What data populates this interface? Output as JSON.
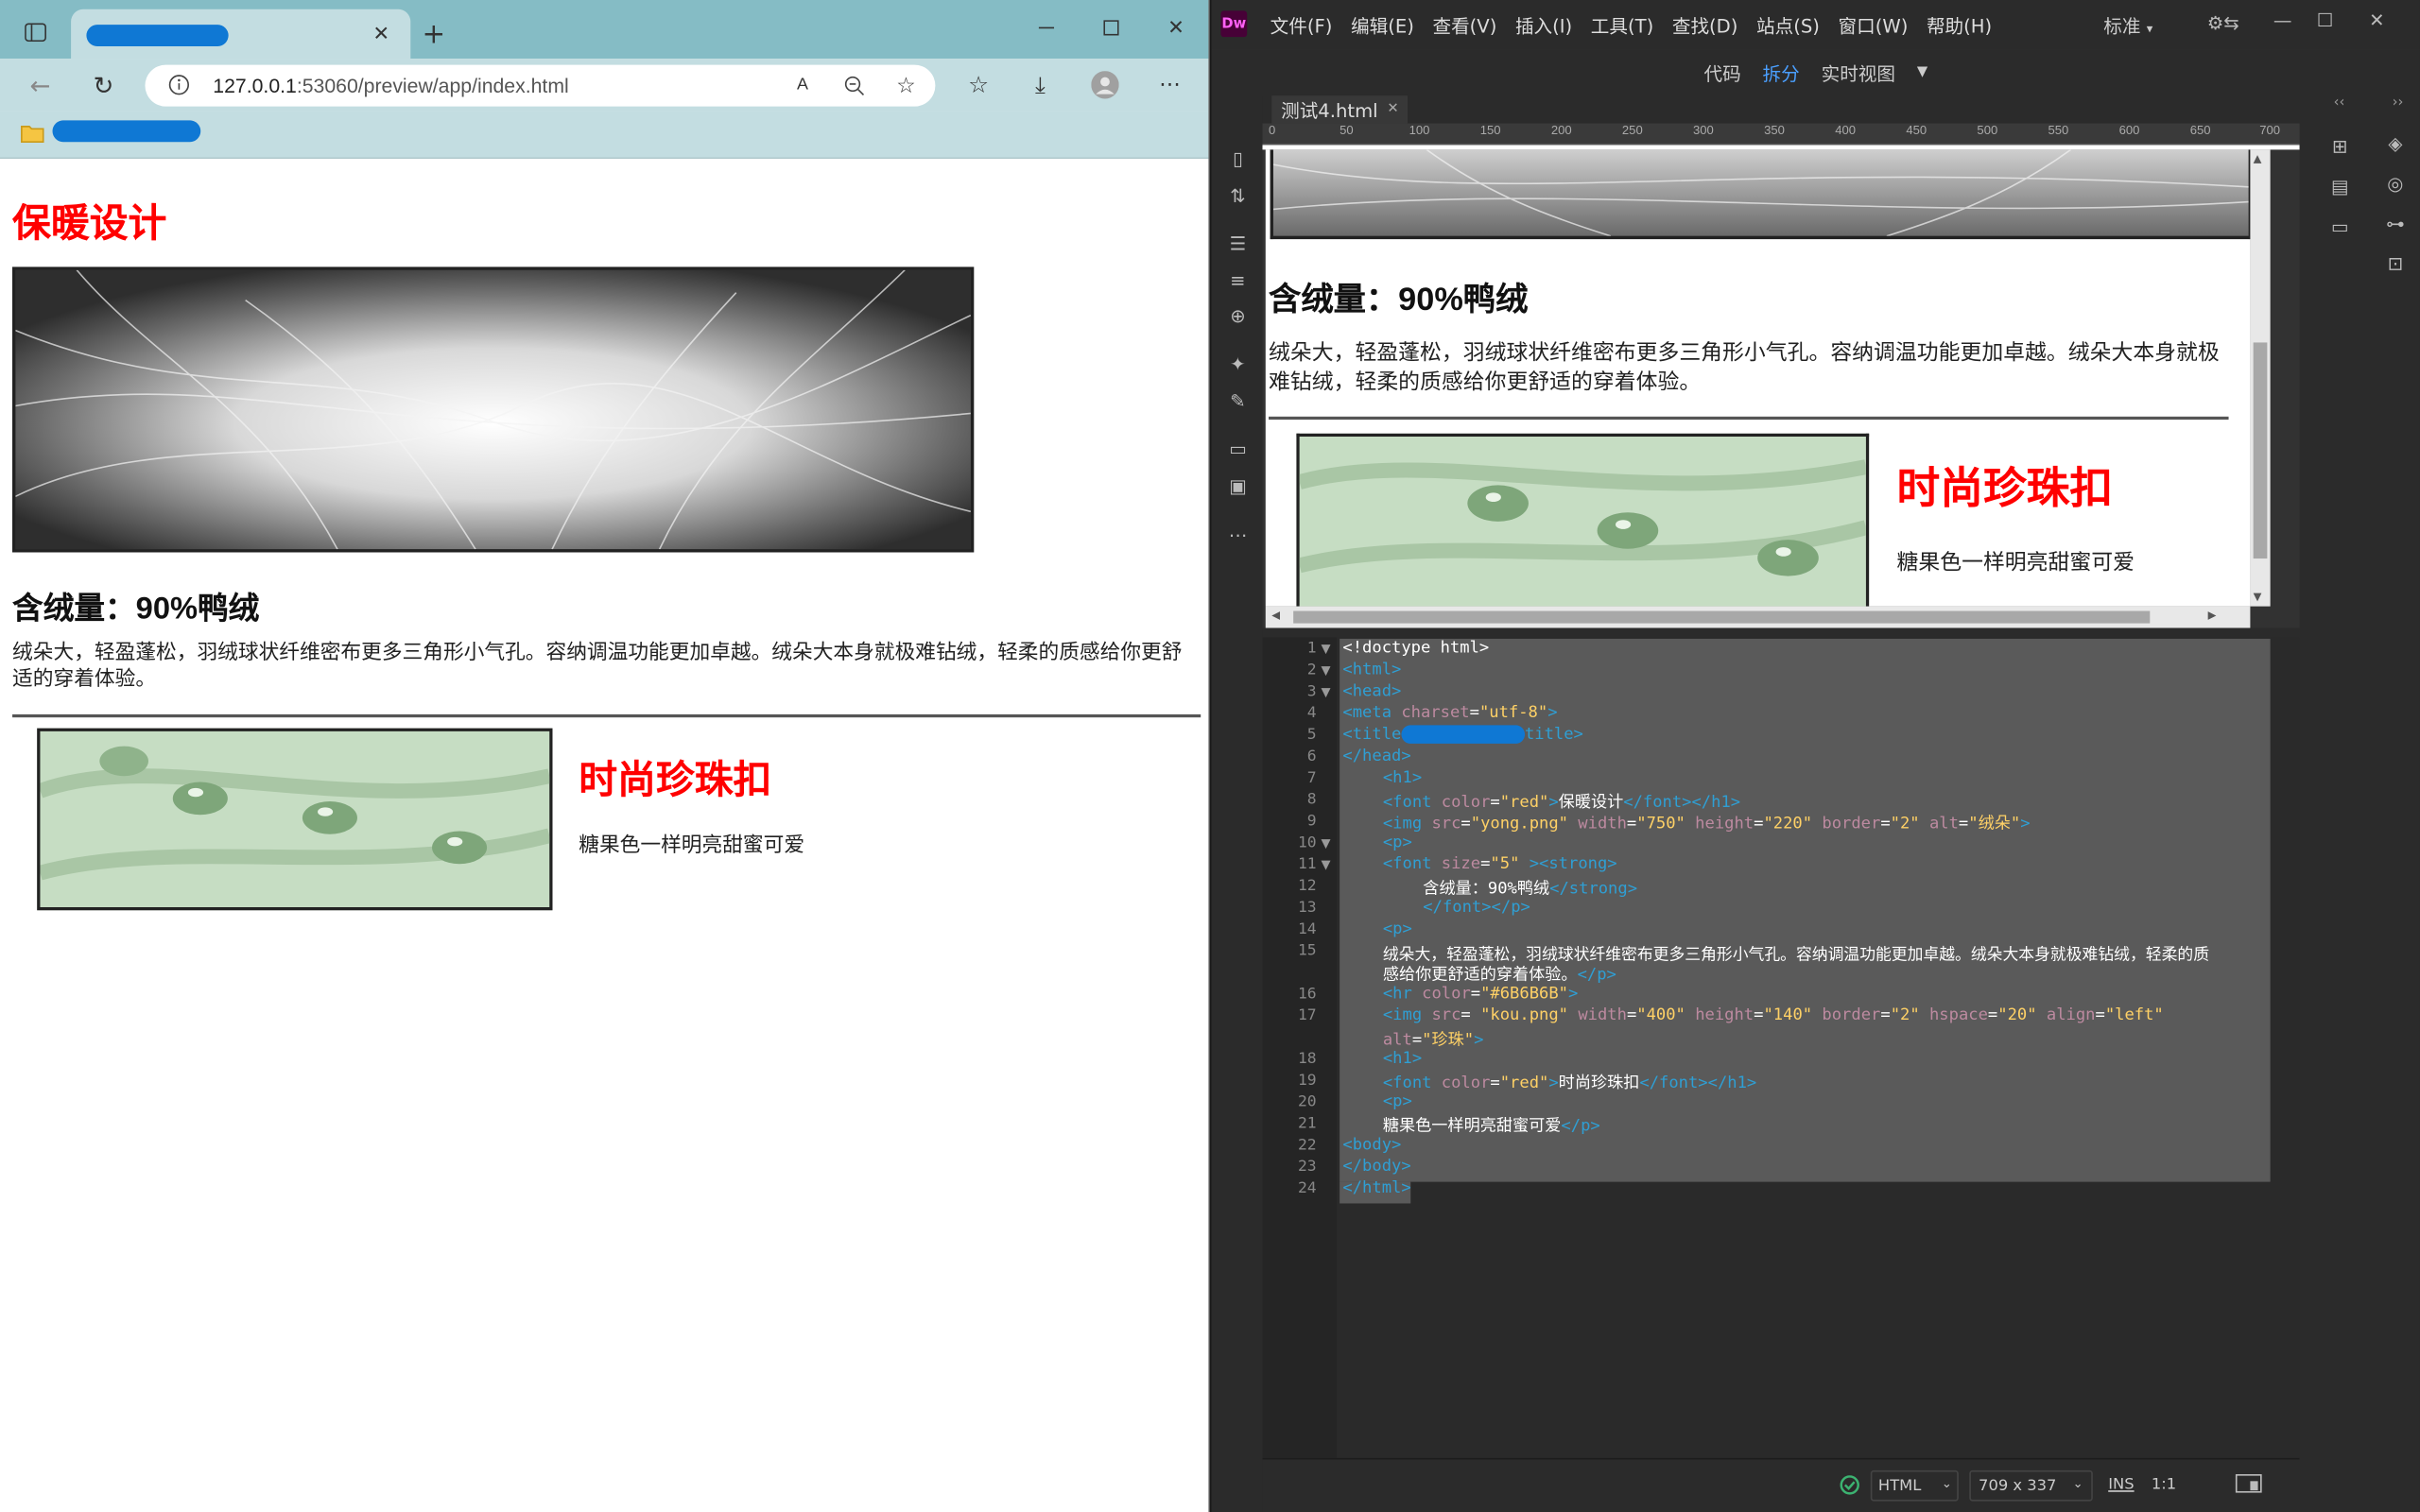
{
  "browser": {
    "url_host": "127.0.0.1",
    "url_rest": ":53060/preview/app/index.html",
    "page": {
      "h1": "保暖设计",
      "h2": "含绒量：90%鸭绒",
      "paragraph": "绒朵大，轻盈蓬松，羽绒球状纤维密布更多三角形小气孔。容纳调温功能更加卓越。绒朵大本身就极难钻绒，轻柔的质感给你更舒适的穿着体验。",
      "h3": "时尚珍珠扣",
      "p2": "糖果色一样明亮甜蜜可爱"
    }
  },
  "dreamweaver": {
    "logo": "Dw",
    "menus": [
      "文件(F)",
      "编辑(E)",
      "查看(V)",
      "插入(I)",
      "工具(T)",
      "查找(D)",
      "站点(S)",
      "窗口(W)",
      "帮助(H)"
    ],
    "workspace": "标准",
    "views": {
      "code": "代码",
      "split": "拆分",
      "live": "实时视图"
    },
    "doc_tab": "测试4.html",
    "ruler": [
      "0",
      "50",
      "100",
      "150",
      "200",
      "250",
      "300",
      "350",
      "400",
      "450",
      "500",
      "550",
      "600",
      "650",
      "700"
    ],
    "live": {
      "h2": "含绒量：90%鸭绒",
      "paragraph": "绒朵大，轻盈蓬松，羽绒球状纤维密布更多三角形小气孔。容纳调温功能更加卓越。绒朵大本身就极难钻绒，轻柔的质感给你更舒适的穿着体验。",
      "h3": "时尚珍珠扣",
      "p2": "糖果色一样明亮甜蜜可爱"
    },
    "line_numbers": [
      "1",
      "2",
      "3",
      "4",
      "5",
      "6",
      "7",
      "8",
      "9",
      "10",
      "11",
      "12",
      "13",
      "14",
      "15",
      "16",
      "17",
      "18",
      "19",
      "20",
      "21",
      "22",
      "23",
      "24"
    ],
    "code": {
      "l1": "<!doctype html>",
      "l2": "<html>",
      "l3": "<head>",
      "l4a": "<meta ",
      "l4b": "charset",
      "l4c": "=",
      "l4d": "\"utf-8\"",
      "l4e": ">",
      "l5a": "<title",
      "l5b": "title>",
      "l6": "</head>",
      "l7": "<h1>",
      "l8a": "<font ",
      "l8b": "color",
      "l8c": "=",
      "l8d": "\"red\"",
      "l8e": ">",
      "l8f": "保暖设计",
      "l8g": "</font></h1>",
      "l9a": "<img ",
      "l9b": "src",
      "l9c": "=",
      "l9d": "\"yong.png\"",
      "l9e": " width",
      "l9f": "=",
      "l9g": "\"750\"",
      "l9h": " height",
      "l9i": "=",
      "l9j": "\"220\"",
      "l9k": " border",
      "l9l": "=",
      "l9m": "\"2\"",
      "l9n": " alt",
      "l9o": "=",
      "l9p": "\"绒朵\"",
      "l9q": ">",
      "l10": "<p>",
      "l11a": "<font ",
      "l11b": "size",
      "l11c": "=",
      "l11d": "\"5\"",
      "l11e": " ><strong>",
      "l12a": "含绒量：90%鸭绒",
      "l12b": "</strong>",
      "l13": "</font></p>",
      "l14": "<p>",
      "l15": "绒朵大，轻盈蓬松，羽绒球状纤维密布更多三角形小气孔。容纳调温功能更加卓越。绒朵大本身就极难钻绒，轻柔的质",
      "l15b_text": "感给你更舒适的穿着体验。",
      "l15b_tag": "</p>",
      "l16a": "<hr ",
      "l16b": "color",
      "l16c": "=",
      "l16d": "\"#6B6B6B\"",
      "l16e": ">",
      "l17a": "<img ",
      "l17b": "src",
      "l17c": "= ",
      "l17d": "\"kou.png\"",
      "l17e": " width",
      "l17f": "=",
      "l17g": "\"400\"",
      "l17h": " height",
      "l17i": "=",
      "l17j": "\"140\"",
      "l17k": " border",
      "l17l": "=",
      "l17m": "\"2\"",
      "l17n": " hspace",
      "l17o": "=",
      "l17p": "\"20\"",
      "l17q": " align",
      "l17r": "=",
      "l17s": "\"left\"",
      "l17b_attr": "alt",
      "l17b_eq": "=",
      "l17b_val": "\"珍珠\"",
      "l17b_end": ">",
      "l18": "<h1>",
      "l19a": "<font ",
      "l19b": "color",
      "l19c": "=",
      "l19d": "\"red\"",
      "l19e": ">",
      "l19f": "时尚珍珠扣",
      "l19g": "</font></h1>",
      "l20": "<p>",
      "l21a": "糖果色一样明亮甜蜜可爱",
      "l21b": "</p>",
      "l22": "<body>",
      "l23": "</body>",
      "l24": "</html>"
    },
    "status": {
      "lang": "HTML",
      "size": "709 x 337",
      "ins": "INS",
      "ratio": "1:1"
    }
  }
}
